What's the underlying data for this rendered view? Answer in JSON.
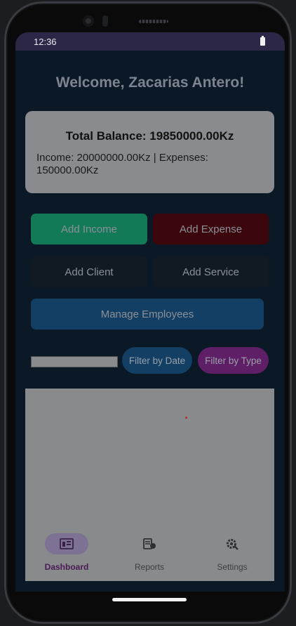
{
  "status_bar": {
    "time": "12:36"
  },
  "header": {
    "welcome": "Welcome, Zacarias Antero!"
  },
  "balance_card": {
    "total": "Total Balance: 19850000.00Kz",
    "summary": "Income: 20000000.00Kz | Expenses: 150000.00Kz"
  },
  "actions": {
    "add_income": "Add Income",
    "add_expense": "Add Expense",
    "add_client": "Add Client",
    "add_service": "Add Service",
    "manage_employees": "Manage Employees"
  },
  "filters": {
    "input_value": "",
    "by_date": "Filter by Date",
    "by_type": "Filter by Type"
  },
  "bottom_nav": {
    "items": [
      {
        "label": "Dashboard",
        "icon": "dashboard-icon",
        "active": true
      },
      {
        "label": "Reports",
        "icon": "reports-icon",
        "active": false
      },
      {
        "label": "Settings",
        "icon": "settings-icon",
        "active": false
      }
    ]
  },
  "colors": {
    "screen_bg": "#0b1826",
    "status_bar": "#2c2647",
    "card_bg": "#8a8b8e",
    "income": "#127a57",
    "expense": "#3b060c",
    "neutral_button": "#111a23",
    "primary_blue": "#123f63",
    "filter_type": "#5e1f66",
    "nav_active": "#4a1a55"
  }
}
